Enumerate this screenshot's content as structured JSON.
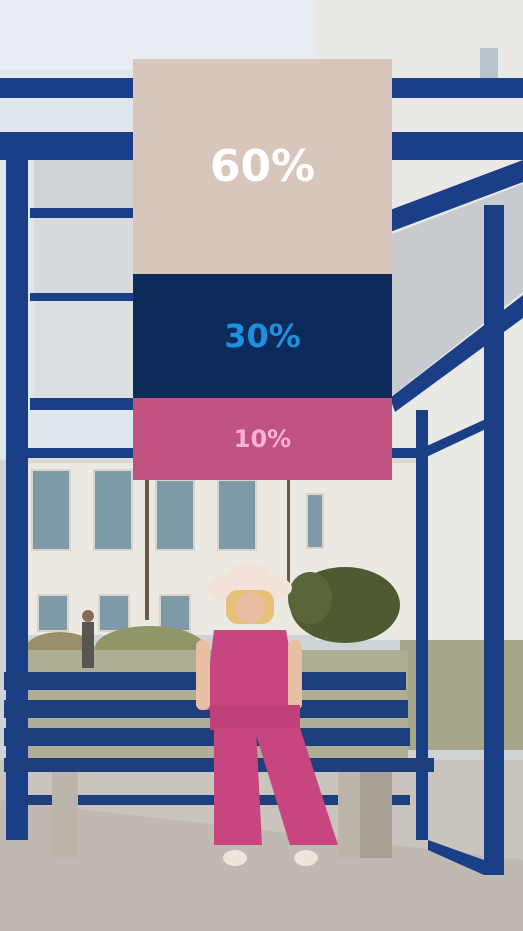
{
  "palette": {
    "swatches": [
      {
        "label": "60%",
        "value": 60,
        "color": "#d8c5bb",
        "text_color": "#ffffff"
      },
      {
        "label": "30%",
        "value": 30,
        "color": "#0c2a5a",
        "text_color": "#1f8fe0"
      },
      {
        "label": "10%",
        "value": 10,
        "color": "#c0527f",
        "text_color": "#ffb0d8"
      }
    ]
  },
  "colors": {
    "sky": "#dfe7ee",
    "shelter_blue": "#1b3f87",
    "building": "#ece8e2",
    "ground": "#c9c4be",
    "outfit_pink": "#c8467f",
    "hat": "#f3e2da"
  }
}
